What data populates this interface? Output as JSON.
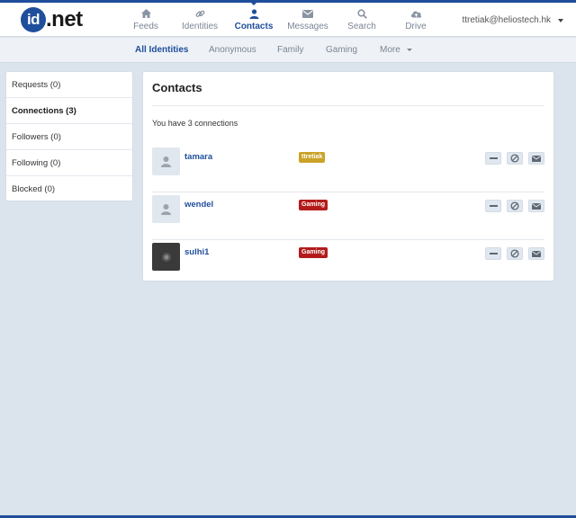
{
  "logo": {
    "mark": "id",
    "text": ".net"
  },
  "nav": [
    {
      "label": "Feeds",
      "icon": "home-icon",
      "active": false
    },
    {
      "label": "Identities",
      "icon": "link-icon",
      "active": false
    },
    {
      "label": "Contacts",
      "icon": "person-icon",
      "active": true
    },
    {
      "label": "Messages",
      "icon": "envelope-icon",
      "active": false
    },
    {
      "label": "Search",
      "icon": "search-icon",
      "active": false
    },
    {
      "label": "Drive",
      "icon": "cloud-icon",
      "active": false
    }
  ],
  "user": {
    "email": "ttretiak@heliostech.hk"
  },
  "subnav": [
    {
      "label": "All Identities",
      "active": true
    },
    {
      "label": "Anonymous",
      "active": false
    },
    {
      "label": "Family",
      "active": false
    },
    {
      "label": "Gaming",
      "active": false
    },
    {
      "label": "More",
      "active": false,
      "has_caret": true
    }
  ],
  "sidebar": [
    {
      "label": "Requests (0)",
      "active": false
    },
    {
      "label": "Connections (3)",
      "active": true
    },
    {
      "label": "Followers (0)",
      "active": false
    },
    {
      "label": "Following (0)",
      "active": false
    },
    {
      "label": "Blocked (0)",
      "active": false
    }
  ],
  "contacts": {
    "title": "Contacts",
    "summary": "You have 3 connections",
    "rows": [
      {
        "name": "tamara",
        "tag": "ttretiak",
        "tag_color": "#c9a227",
        "avatar": "default"
      },
      {
        "name": "wendel",
        "tag": "Gaming",
        "tag_color": "#b31b1b",
        "avatar": "default"
      },
      {
        "name": "sulhi1",
        "tag": "Gaming",
        "tag_color": "#b31b1b",
        "avatar": "dark"
      }
    ]
  },
  "colors": {
    "brand": "#1f4e9c",
    "background": "#dbe3ec"
  }
}
